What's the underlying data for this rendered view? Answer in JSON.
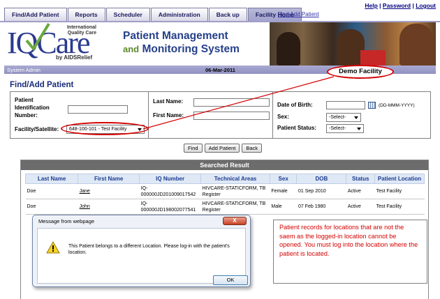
{
  "nav": {
    "tabs": [
      "Find/Add Patient",
      "Reports",
      "Scheduler",
      "Administration",
      "Back up",
      "Facility Home"
    ],
    "active_tab": "Facility Home",
    "sublink": "Find Add Patient",
    "links": [
      "Help",
      "Password",
      "Logout"
    ],
    "separator": "|"
  },
  "header": {
    "logo_text": "IQCare",
    "logo_tagline": "International Quality Care",
    "logo_sub": "by AIDSRelief",
    "title_line1": "Patient Management",
    "title_and": "and",
    "title_line2": "Monitoring System"
  },
  "infobar": {
    "user": "System Admin",
    "date": "06-Mar-2011"
  },
  "callout": {
    "text": "Demo Facility"
  },
  "page_title": "Find/Add Patient",
  "form": {
    "patient_id_label": "Patient Identification Number:",
    "patient_id_value": "",
    "facility_label": "Facility/Satellite:",
    "facility_value": "648-100-101 - Test Facility",
    "last_name_label": "Last Name:",
    "last_name_value": "",
    "first_name_label": "First Name:",
    "first_name_value": "",
    "dob_label": "Date of Birth:",
    "dob_value": "",
    "dob_format": "(DD-MMM-YYYY)",
    "sex_label": "Sex:",
    "sex_value": "-Select-",
    "status_label": "Patient Status:",
    "status_value": "-Select-"
  },
  "buttons": {
    "find": "Find",
    "add_patient": "Add Patient",
    "back": "Back"
  },
  "results": {
    "title": "Searched Result",
    "columns": [
      "Last Name",
      "First Name",
      "IQ Number",
      "Technical Areas",
      "Sex",
      "DOB",
      "Status",
      "Patient Location"
    ],
    "rows": [
      [
        "Doe",
        "Jane",
        "IQ-000000JD201009017542",
        "HIVCARE-STATICFORM, TB Register",
        "Female",
        "01 Sep 2010",
        "Active",
        "Test Facility"
      ],
      [
        "Doe",
        "John",
        "IQ-000000JD198002077541",
        "HIVCARE-STATICFORM, TB Register",
        "Male",
        "07 Feb 1980",
        "Active",
        "Test Facility"
      ]
    ]
  },
  "dialog": {
    "title": "Message from webpage",
    "close": "X",
    "message": "This Patient belongs to a different Location. Please log-in with the patient's location.",
    "ok": "OK"
  },
  "note": {
    "text": "Patient records for locations that are not the saem as the logged-in location cannot be opened. You must log into the location where the patient is located."
  },
  "colors": {
    "nav_active": "#a1a1cc",
    "title_blue": "#1a2a7a",
    "annotation_red": "#d40000",
    "result_header": "#6c6c6c"
  }
}
